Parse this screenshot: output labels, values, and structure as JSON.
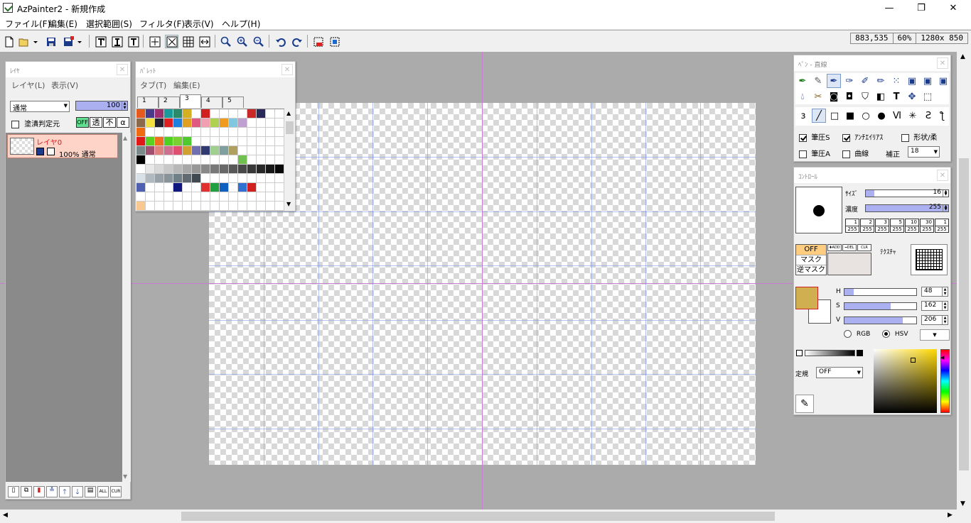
{
  "window": {
    "title": "AzPainter2 - 新規作成",
    "minimize": "—",
    "maximize": "❐",
    "close": "✕"
  },
  "menu": [
    "ファイル(F)",
    "編集(E)",
    "選択範囲(S)",
    "フィルタ(F)",
    "表示(V)",
    "ヘルプ(H)"
  ],
  "status": {
    "coords": "883,535",
    "zoom": "60%",
    "size": "1280x 850"
  },
  "layer_panel": {
    "title": "ﾚｲﾔ",
    "menu": [
      "レイヤ(L)",
      "表示(V)"
    ],
    "blend_mode": "通常",
    "opacity": "100",
    "fill_ref_label": "塗潰判定元",
    "mode_buttons": [
      "OFF",
      "透",
      "不",
      "α"
    ],
    "layer": {
      "name": "レイヤ0",
      "info": "100% 通常"
    },
    "bottom_buttons": [
      "new-layer",
      "copy-layer",
      "delete-layer",
      "merge-down",
      "move-up",
      "move-down",
      "properties",
      "ALL",
      "CUR"
    ]
  },
  "palette_panel": {
    "title": "ﾊﾟﾚｯﾄ",
    "menu": [
      "タブ(T)",
      "編集(E)"
    ],
    "tabs": [
      "1",
      "2",
      "3",
      "4",
      "5"
    ],
    "active_tab": "3",
    "rows": [
      [
        "#e65a1e",
        "#4a3a8a",
        "#9a3070",
        "#1a9a9a",
        "#2a8a6a",
        "#d4b020",
        "#ffffff",
        "#d02020",
        "#ffffff",
        "#ffffff",
        "#ffffff",
        "#ffffff",
        "#c82828",
        "#2a2a5a",
        "#ffffff",
        "#ffffff"
      ],
      [
        "#8a6a4a",
        "#f0e040",
        "#202030",
        "#e02020",
        "#2080e0",
        "#e0a020",
        "#e05a80",
        "#f0a0b0",
        "#b0d050",
        "#f09a20",
        "#80c8e0",
        "#c0a0d0",
        "#ffffff",
        "#ffffff",
        "#ffffff",
        "#ffffff"
      ],
      [
        "#f06a10",
        "#ffffff",
        "#ffffff",
        "#ffffff",
        "#ffffff",
        "#ffffff",
        "#ffffff",
        "#ffffff",
        "#ffffff",
        "#ffffff",
        "#ffffff",
        "#ffffff",
        "#ffffff",
        "#ffffff",
        "#ffffff",
        "#ffffff"
      ],
      [
        "#e01818",
        "#5ad020",
        "#f07020",
        "#50d020",
        "#7ad030",
        "#50c830",
        "#ffffff",
        "#ffffff",
        "#ffffff",
        "#ffffff",
        "#ffffff",
        "#ffffff",
        "#ffffff",
        "#ffffff",
        "#ffffff",
        "#ffffff"
      ],
      [
        "#7a8a8a",
        "#a05070",
        "#e08080",
        "#d07090",
        "#e05070",
        "#d0a030",
        "#7070b0",
        "#303a70",
        "#a0d090",
        "#80a0a0",
        "#b0a060",
        "#ffffff",
        "#ffffff",
        "#ffffff",
        "#ffffff",
        "#ffffff"
      ],
      [
        "#000000",
        "#ffffff",
        "#ffffff",
        "#ffffff",
        "#ffffff",
        "#ffffff",
        "#ffffff",
        "#ffffff",
        "#ffffff",
        "#ffffff",
        "#ffffff",
        "#70c050",
        "#ffffff",
        "#ffffff",
        "#ffffff",
        "#ffffff"
      ],
      [
        "#ffffff",
        "#e8e8e8",
        "#d8d8d8",
        "#c8c8c8",
        "#b8b8b8",
        "#a8a8a8",
        "#989898",
        "#888888",
        "#787878",
        "#686868",
        "#585858",
        "#484848",
        "#383838",
        "#282828",
        "#181818",
        "#080808"
      ],
      [
        "#d8e0e8",
        "#b0b8c0",
        "#98a0a8",
        "#88949a",
        "#708088",
        "#606a70",
        "#404850",
        "#ffffff",
        "#ffffff",
        "#ffffff",
        "#ffffff",
        "#ffffff",
        "#ffffff",
        "#ffffff",
        "#ffffff",
        "#ffffff"
      ],
      [
        "#5060b0",
        "#ffffff",
        "#ffffff",
        "#ffffff",
        "#101880",
        "#ffffff",
        "#ffffff",
        "#e03030",
        "#20a040",
        "#1060c0",
        "#ffffff",
        "#3070d0",
        "#d02020",
        "#ffffff",
        "#ffffff",
        "#ffffff"
      ],
      [
        "#ffffff",
        "#ffffff",
        "#ffffff",
        "#ffffff",
        "#ffffff",
        "#ffffff",
        "#ffffff",
        "#ffffff",
        "#ffffff",
        "#ffffff",
        "#ffffff",
        "#ffffff",
        "#ffffff",
        "#ffffff",
        "#ffffff",
        "#ffffff"
      ],
      [
        "#f8c890",
        "#ffffff",
        "#ffffff",
        "#ffffff",
        "#ffffff",
        "#ffffff",
        "#ffffff",
        "#ffffff",
        "#ffffff",
        "#ffffff",
        "#ffffff",
        "#ffffff",
        "#ffffff",
        "#ffffff",
        "#ffffff",
        "#ffffff"
      ]
    ]
  },
  "tool_panel": {
    "title": "ﾍﾟﾝ - 直線",
    "opt_pressure_s": "筆圧S",
    "opt_antialias": "ｱﾝﾁｴｲﾘｱｽ",
    "opt_shape": "形状/柔",
    "opt_pressure_a": "筆圧A",
    "opt_curve": "曲線",
    "correction_label": "補正",
    "correction_value": "18"
  },
  "control_panel": {
    "title": "ｺﾝﾄﾛｰﾙ",
    "size_label": "ｻｲｽﾞ",
    "size_value": "16",
    "size_fraction": 0.1,
    "density_label": "濃度",
    "density_value": "255",
    "density_fraction": 1.0,
    "presets": [
      [
        "1",
        "255"
      ],
      [
        "2",
        "255"
      ],
      [
        "3",
        "255"
      ],
      [
        "5",
        "255"
      ],
      [
        "10",
        "255"
      ],
      [
        "30",
        "255"
      ],
      [
        "1",
        "255"
      ]
    ],
    "mask_off": "OFF",
    "mask": "マスク",
    "reverse_mask": "逆マスク",
    "mask_add": "✚ADD",
    "mask_del": "━DEL",
    "mask_clr": "CLR",
    "texture_label": "ﾃｸｽﾁｬ",
    "h_label": "H",
    "h_value": "48",
    "h_fraction": 0.13,
    "s_label": "S",
    "s_value": "162",
    "s_fraction": 0.64,
    "v_label": "V",
    "v_value": "206",
    "v_fraction": 0.81,
    "fg_color": "#cfaf4f",
    "bg_color": "#ffffff",
    "rgb_label": "RGB",
    "hsv_label": "HSV",
    "ruler_label": "定規",
    "ruler_value": "OFF",
    "picker_hue": "#ffd800"
  }
}
